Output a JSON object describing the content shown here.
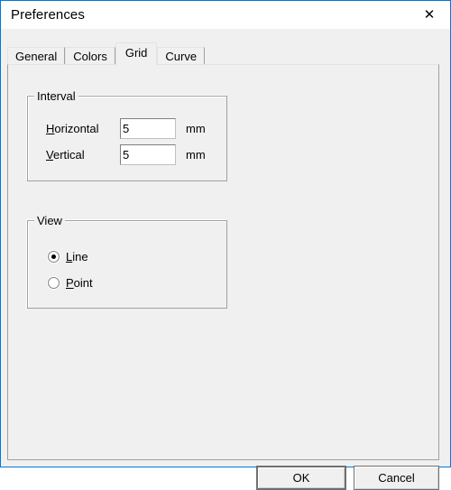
{
  "window": {
    "title": "Preferences",
    "close_icon": "close-icon",
    "close_glyph": "✕",
    "accent_color": "#0078d7",
    "background_color": "#f0f0f0"
  },
  "tabs": [
    {
      "label": "General",
      "selected": false
    },
    {
      "label": "Colors",
      "selected": false
    },
    {
      "label": "Grid",
      "selected": true
    },
    {
      "label": "Curve",
      "selected": false
    }
  ],
  "groups": {
    "interval": {
      "label": "Interval",
      "fields": [
        {
          "label_prefix": "",
          "accel": "H",
          "label_suffix": "orizontal",
          "value": "5",
          "placeholder": "",
          "unit": "mm"
        },
        {
          "label_prefix": "",
          "accel": "V",
          "label_suffix": "ertical",
          "value": "5",
          "placeholder": "",
          "unit": "mm"
        }
      ]
    },
    "view": {
      "label": "View",
      "options": [
        {
          "accel": "L",
          "label_suffix": "ine",
          "selected": true
        },
        {
          "accel": "P",
          "label_suffix": "oint",
          "selected": false
        }
      ]
    }
  },
  "buttons": {
    "ok": "OK",
    "cancel": "Cancel"
  }
}
